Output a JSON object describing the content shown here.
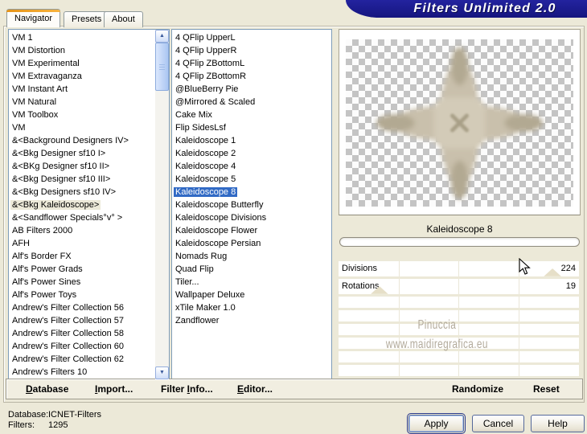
{
  "window": {
    "title": "Filters Unlimited 2.0"
  },
  "tabs": [
    {
      "label": "Navigator",
      "active": true
    },
    {
      "label": "Presets",
      "active": false
    },
    {
      "label": "About",
      "active": false
    }
  ],
  "category_list": {
    "selected_index": 13,
    "items": [
      "VM 1",
      "VM Distortion",
      "VM Experimental",
      "VM Extravaganza",
      "VM Instant Art",
      "VM Natural",
      "VM Toolbox",
      "VM",
      "&<Background Designers IV>",
      "&<Bkg Designer sf10 I>",
      "&<BKg Designer sf10 II>",
      "&<Bkg Designer sf10 III>",
      "&<Bkg Designers sf10 IV>",
      "&<Bkg Kaleidoscope>",
      "&<Sandflower Specials°v° >",
      "AB Filters 2000",
      "AFH",
      "Alf's Border FX",
      "Alf's Power Grads",
      "Alf's Power Sines",
      "Alf's Power Toys",
      "Andrew's Filter Collection 56",
      "Andrew's Filter Collection 57",
      "Andrew's Filter Collection 58",
      "Andrew's Filter Collection 60",
      "Andrew's Filter Collection 62",
      "Andrew's Filters 10"
    ]
  },
  "filter_list": {
    "selected_index": 12,
    "items": [
      "4 QFlip UpperL",
      "4 QFlip UpperR",
      "4 QFlip ZBottomL",
      "4 QFlip ZBottomR",
      "@BlueBerry Pie",
      "@Mirrored & Scaled",
      "Cake Mix",
      "Flip SidesLsf",
      "Kaleidoscope 1",
      "Kaleidoscope 2",
      "Kaleidoscope 4",
      "Kaleidoscope 5",
      "Kaleidoscope 8",
      "Kaleidoscope Butterfly",
      "Kaleidoscope Divisions",
      "Kaleidoscope Flower",
      "Kaleidoscope Persian",
      "Nomads Rug",
      "Quad Flip",
      "Tiler...",
      "Wallpaper Deluxe",
      "xTile Maker 1.0",
      "Zandflower"
    ]
  },
  "preview": {
    "filter_name": "Kaleidoscope 8"
  },
  "sliders": [
    {
      "label": "Divisions",
      "value": "224",
      "thumb_percent": 89
    },
    {
      "label": "Rotations",
      "value": "19",
      "thumb_percent": 17
    }
  ],
  "watermark": {
    "line1": "Pinuccia",
    "line2": "www.maidiregrafica.eu"
  },
  "toolbar": {
    "database": {
      "u": "D",
      "rest": "atabase"
    },
    "import": {
      "u": "I",
      "rest": "mport..."
    },
    "filter_info": {
      "pre": "Filter ",
      "u": "I",
      "rest": "nfo..."
    },
    "editor": {
      "u": "E",
      "rest": "ditor..."
    },
    "randomize": "Randomize",
    "reset": "Reset"
  },
  "status": {
    "database_label": "Database:",
    "database_value": "ICNET-Filters",
    "filters_label": "Filters:",
    "filters_value": "1295"
  },
  "action_buttons": {
    "apply": "Apply",
    "cancel": "Cancel",
    "help": "Help"
  },
  "colors": {
    "background": "#ece9d8",
    "banner_navy": "#1b1b9a",
    "selection_blue": "#316ac5",
    "inactive_selection": "#ece9d8",
    "tab_highlight_orange": "#e59317",
    "checker_gray": "#c4c4c4",
    "pattern_beige": "#cbc2ae"
  }
}
